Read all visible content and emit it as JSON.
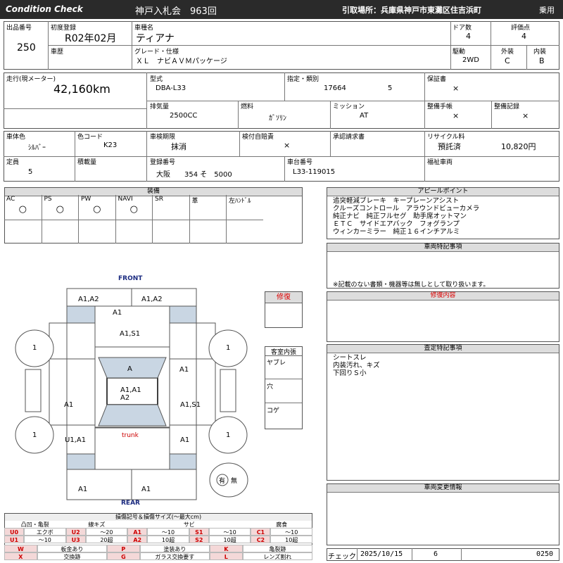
{
  "header": {
    "brand": "Condition   Check",
    "auction": "神戸入札会　963回",
    "pickup": "引取場所：兵庫県神戸市東灘区住吉浜町",
    "category": "乗用"
  },
  "info": {
    "lot_label": "出品番号",
    "lot_value": "250",
    "first_reg_label": "初度登録",
    "first_reg_value": "R02年02月",
    "model_label": "車種名",
    "model_value": "ティアナ",
    "doors_label": "ドア数",
    "doors_value": "4",
    "score_label": "評価点",
    "score_value": "4",
    "history_label": "車歴",
    "grade_label": "グレード・仕様",
    "grade_value": "ＸＬ　ナビＡＶＭパッケージ",
    "drive_label": "駆動",
    "drive_value": "2WD",
    "exterior_label": "外装",
    "exterior_value": "C",
    "interior_label": "内装",
    "interior_value": "B",
    "mileage_label": "走行(現メーター)",
    "mileage_value": "42,160km",
    "type_label": "型式",
    "type_value": "DBA-L33",
    "spec_label": "指定・類別",
    "spec_value1": "17664",
    "spec_value2": "5",
    "warranty_label": "保証書",
    "warranty_value": "×",
    "displacement_label": "排気量",
    "displacement_value": "2500CC",
    "fuel_label": "燃料",
    "fuel_value": "ｶﾞｿﾘﾝ",
    "mission_label": "ミッション",
    "mission_value": "AT",
    "manual_label": "整備手帳",
    "manual_value": "×",
    "maint_label": "整備記録",
    "maint_value": "×",
    "color_label": "車体色",
    "color_value": "ｼﾙﾊﾞｰ",
    "colorcode_label": "色コード",
    "colorcode_value": "K23",
    "inspection_label": "車検期限",
    "inspection_value": "抹消",
    "selfins_label": "検付自賠責",
    "selfins_value": "×",
    "approval_label": "承認請求書",
    "recycle_label": "リサイクル料",
    "recycle_status": "預託済",
    "recycle_value": "10,820円",
    "capacity_label": "定員",
    "capacity_value": "5",
    "load_label": "積載量",
    "regno_label": "登録番号",
    "regno_value": "大阪　　354 そ　5000",
    "chassis_label": "車台番号",
    "chassis_value": "L33-119015",
    "welfare_label": "福祉車両"
  },
  "equipment": {
    "title": "装備",
    "headers": [
      "AC",
      "PS",
      "PW",
      "NAVI",
      "SR",
      "革",
      "左ﾊﾝﾄﾞﾙ"
    ],
    "values": [
      "○",
      "○",
      "○",
      "○",
      "",
      "",
      ""
    ]
  },
  "appeal": {
    "title": "アピールポイント",
    "lines": [
      "追突軽減ブレーキ　キープレーンアシスト",
      "クルーズコントロール　アラウンドビューカメラ",
      "純正ナビ　純正フルセグ　助手席オットマン",
      "ＥＴＣ　サイドエアバック　フォグランプ",
      "ウィンカーミラー　純正１６インチアルミ"
    ]
  },
  "special": {
    "title": "車両特記事項",
    "note": "※記載のない書類・機器等は無しとして取り扱います。"
  },
  "repair_content": {
    "title": "修復内容"
  },
  "assessment": {
    "title": "査定特記事項",
    "lines": [
      "シートスレ",
      "内装汚れ、キズ",
      "下回りＳ小"
    ]
  },
  "change_info": {
    "title": "車両変更情報"
  },
  "check": {
    "label": "チェック",
    "date": "2025/10/15",
    "num": "6",
    "code": "0250"
  },
  "diagram": {
    "front": "FRONT",
    "rear": "REAR",
    "trunk": "trunk",
    "repair_label": "修復",
    "cabin_label": "客室内張",
    "cabin_items": [
      "ヤブレ",
      "穴",
      "コゲ"
    ],
    "tire": "1",
    "marks": {
      "front_left": "A1,A2",
      "front_right": "A1,A2",
      "front_center": "A1",
      "hood": "A1,S1",
      "windshield": "A",
      "roof1": "A1,A1",
      "roof2": "A2",
      "left_front_door": "A1",
      "right_front_door": "A1",
      "left_rear_door": "A1",
      "right_rear_door": "A1,S1",
      "left_quarter": "U1,A1",
      "right_quarter": "A1",
      "rear_left": "A1",
      "rear_right": "A1"
    },
    "spare_yes": "有",
    "spare_no": "無"
  },
  "legend": {
    "title": "損傷記号＆損傷サイズ(〜最大cm)",
    "groups": [
      "凸凹・亀裂",
      "線キズ",
      "サビ",
      "腐食"
    ],
    "rows": [
      [
        [
          "U0",
          "エクボ"
        ],
        [
          "U2",
          "〜20"
        ],
        [
          "A1",
          "〜10"
        ],
        [
          "S1",
          "〜10"
        ],
        [
          "C1",
          "〜10"
        ]
      ],
      [
        [
          "U1",
          "〜10"
        ],
        [
          "U3",
          "20超"
        ],
        [
          "A2",
          "10超"
        ],
        [
          "S2",
          "10超"
        ],
        [
          "C2",
          "10超"
        ]
      ]
    ],
    "rows2": [
      [
        [
          "W",
          "板金あり"
        ],
        [
          "P",
          "塗装あり"
        ],
        [
          "K",
          "亀裂跡"
        ]
      ],
      [
        [
          "X",
          "交換跡"
        ],
        [
          "G",
          "ガラス交換要す"
        ],
        [
          "L",
          "レンズ割れ"
        ]
      ]
    ]
  }
}
